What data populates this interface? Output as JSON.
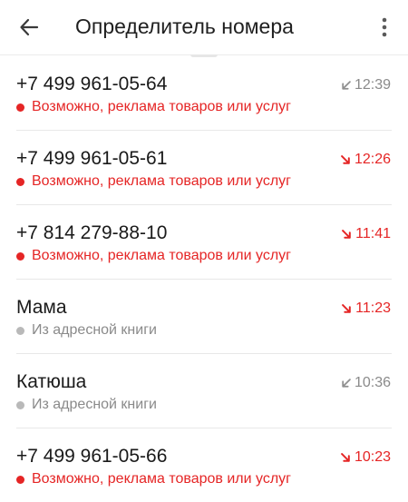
{
  "header": {
    "title": "Определитель номера",
    "back_icon": "arrow-back-icon",
    "menu_icon": "more-vertical-icon"
  },
  "colors": {
    "spam": "#e52525",
    "neutral_dot": "#b9b9b9",
    "neutral_text": "#8a8a8a",
    "incoming_icon": "#8f8f8f",
    "missed": "#e52525"
  },
  "calls": [
    {
      "number": "+7 499 961-05-64",
      "label": "Возможно, реклама товаров или услуг",
      "label_type": "spam",
      "time": "12:39",
      "call_type": "incoming"
    },
    {
      "number": "+7 499 961-05-61",
      "label": "Возможно, реклама товаров или услуг",
      "label_type": "spam",
      "time": "12:26",
      "call_type": "missed"
    },
    {
      "number": "+7 814 279-88-10",
      "label": "Возможно, реклама товаров или услуг",
      "label_type": "spam",
      "time": "11:41",
      "call_type": "missed"
    },
    {
      "number": "Мама",
      "label": "Из адресной книги",
      "label_type": "contact",
      "time": "11:23",
      "call_type": "missed"
    },
    {
      "number": "Катюша",
      "label": "Из адресной книги",
      "label_type": "contact",
      "time": "10:36",
      "call_type": "incoming"
    },
    {
      "number": "+7 499 961-05-66",
      "label": "Возможно, реклама товаров или услуг",
      "label_type": "spam",
      "time": "10:23",
      "call_type": "missed"
    }
  ]
}
